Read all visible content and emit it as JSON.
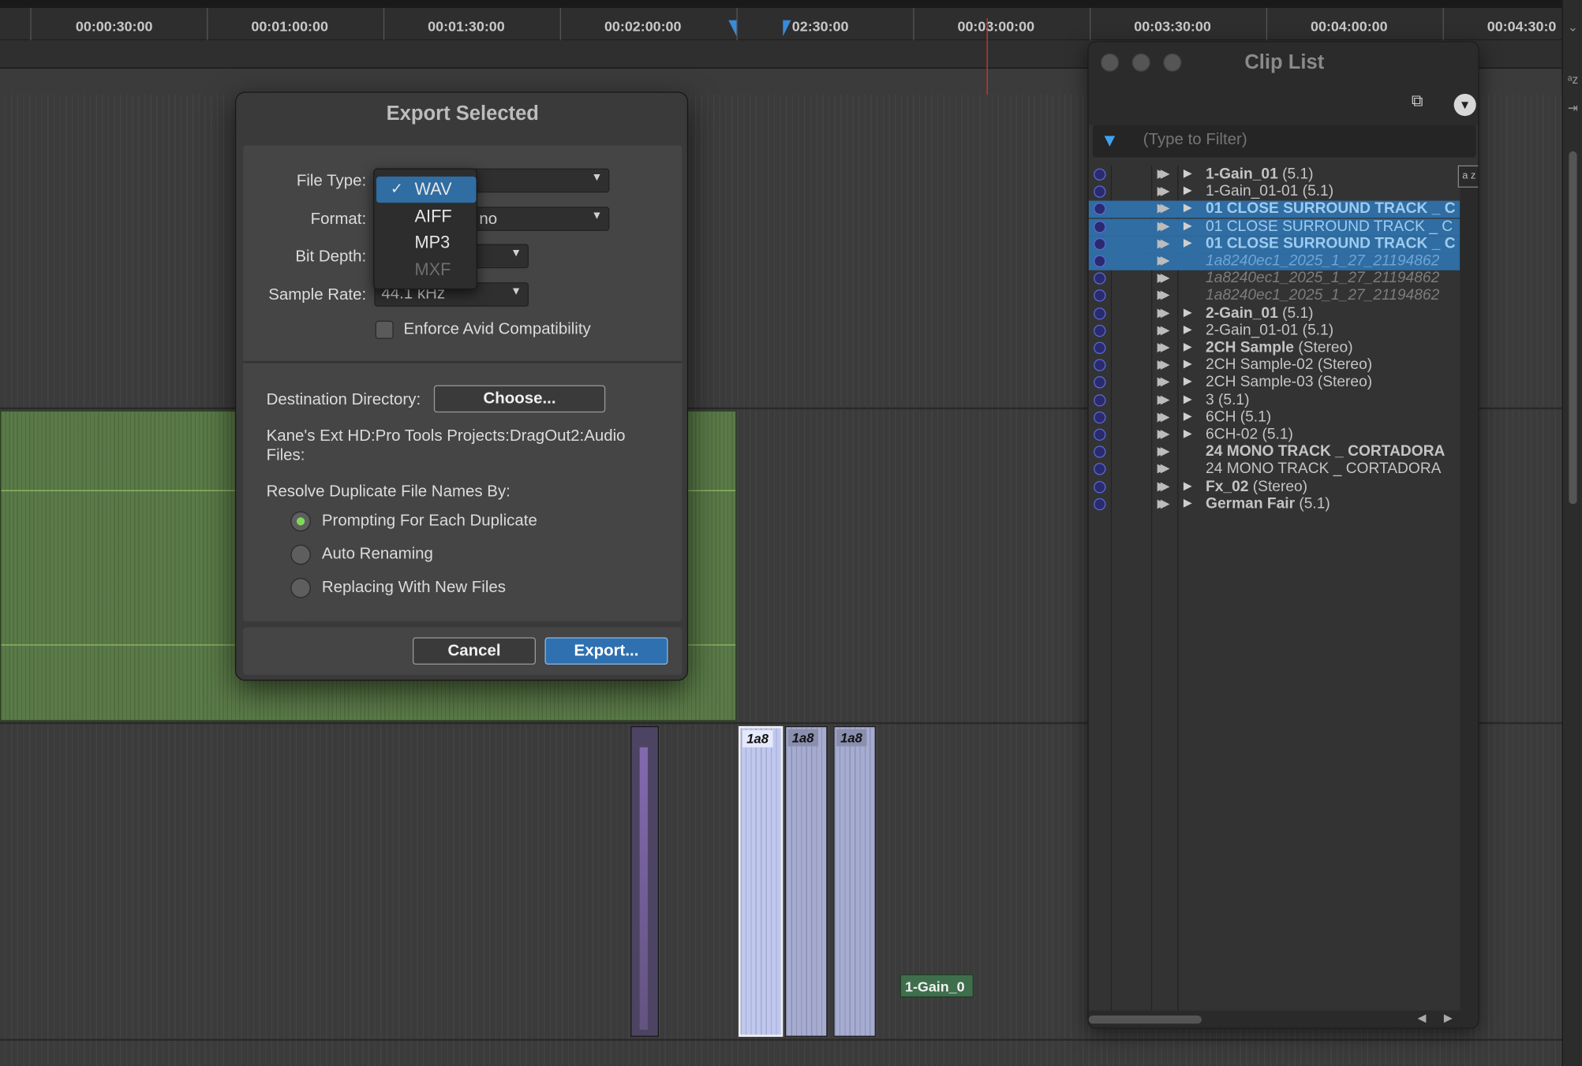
{
  "timeline": {
    "ruler_labels": [
      "00:00:30:00",
      "00:01:00:00",
      "00:01:30:00",
      "00:02:00:00",
      "02:30:00",
      "00:03:00:00",
      "00:03:30:00",
      "00:04:00:00",
      "00:04:30:0"
    ],
    "clips": {
      "region_name_1": "1a8",
      "region_name_2": "1a8",
      "region_name_3": "1a8",
      "bottom_clip_name": "1-Gain_0"
    }
  },
  "export_dialog": {
    "title": "Export Selected",
    "file_type_label": "File Type:",
    "format_label": "Format:",
    "format_value": "no",
    "bit_depth_label": "Bit Depth:",
    "sample_rate_label": "Sample Rate:",
    "sample_rate_value": "44.1 kHz",
    "enforce_label": "Enforce Avid Compatibility",
    "enforce_checked": false,
    "destination_label": "Destination Directory:",
    "choose_label": "Choose...",
    "destination_path": "Kane's Ext HD:Pro Tools Projects:DragOut2:Audio Files:",
    "resolve_label": "Resolve Duplicate File Names By:",
    "resolve_options": [
      {
        "label": "Prompting For Each Duplicate",
        "selected": true
      },
      {
        "label": "Auto Renaming",
        "selected": false
      },
      {
        "label": "Replacing With New Files",
        "selected": false
      }
    ],
    "cancel_label": "Cancel",
    "export_label": "Export...",
    "file_type_menu": {
      "items": [
        {
          "label": "WAV",
          "checked": true,
          "enabled": true
        },
        {
          "label": "AIFF",
          "checked": false,
          "enabled": true
        },
        {
          "label": "MP3",
          "checked": false,
          "enabled": true
        },
        {
          "label": "MXF",
          "checked": false,
          "enabled": false
        }
      ],
      "check_glyph": "✓"
    }
  },
  "clip_list": {
    "title": "Clip List",
    "filter_placeholder": "(Type to Filter)",
    "sort_button": "a z",
    "rows": [
      {
        "name": "1-Gain_01",
        "suffix": " (5.1)",
        "bold": true,
        "italic": false,
        "selected": false,
        "expandable": true
      },
      {
        "name": "1-Gain_01-01",
        "suffix": " (5.1)",
        "bold": false,
        "italic": false,
        "selected": false,
        "expandable": true
      },
      {
        "name": "01 CLOSE SURROUND TRACK _ C",
        "suffix": "",
        "bold": true,
        "italic": false,
        "selected": true,
        "expandable": true
      },
      {
        "name": "01 CLOSE SURROUND TRACK _ C",
        "suffix": "",
        "bold": false,
        "italic": false,
        "selected": true,
        "expandable": true
      },
      {
        "name": "01 CLOSE SURROUND TRACK _ C",
        "suffix": "",
        "bold": true,
        "italic": false,
        "selected": true,
        "expandable": true
      },
      {
        "name": "1a8240ec1_2025_1_27_21194862",
        "suffix": "",
        "bold": false,
        "italic": true,
        "selected": true,
        "expandable": false
      },
      {
        "name": "1a8240ec1_2025_1_27_21194862",
        "suffix": "",
        "bold": false,
        "italic": true,
        "selected": false,
        "expandable": false
      },
      {
        "name": "1a8240ec1_2025_1_27_21194862",
        "suffix": "",
        "bold": false,
        "italic": true,
        "selected": false,
        "expandable": false
      },
      {
        "name": "2-Gain_01",
        "suffix": " (5.1)",
        "bold": true,
        "italic": false,
        "selected": false,
        "expandable": true
      },
      {
        "name": "2-Gain_01-01",
        "suffix": " (5.1)",
        "bold": false,
        "italic": false,
        "selected": false,
        "expandable": true
      },
      {
        "name": "2CH Sample",
        "suffix": " (Stereo)",
        "bold": true,
        "italic": false,
        "selected": false,
        "expandable": true
      },
      {
        "name": "2CH Sample-02",
        "suffix": " (Stereo)",
        "bold": false,
        "italic": false,
        "selected": false,
        "expandable": true
      },
      {
        "name": "2CH Sample-03",
        "suffix": " (Stereo)",
        "bold": false,
        "italic": false,
        "selected": false,
        "expandable": true
      },
      {
        "name": "3",
        "suffix": " (5.1)",
        "bold": false,
        "italic": false,
        "selected": false,
        "expandable": true
      },
      {
        "name": "6CH",
        "suffix": " (5.1)",
        "bold": false,
        "italic": false,
        "selected": false,
        "expandable": true
      },
      {
        "name": "6CH-02",
        "suffix": " (5.1)",
        "bold": false,
        "italic": false,
        "selected": false,
        "expandable": true
      },
      {
        "name": "24 MONO TRACK _ CORTADORA",
        "suffix": "",
        "bold": true,
        "italic": false,
        "selected": false,
        "expandable": false
      },
      {
        "name": "24 MONO TRACK _ CORTADORA",
        "suffix": "",
        "bold": false,
        "italic": false,
        "selected": false,
        "expandable": false
      },
      {
        "name": "Fx_02",
        "suffix": " (Stereo)",
        "bold": true,
        "italic": false,
        "selected": false,
        "expandable": true
      },
      {
        "name": "German Fair",
        "suffix": " (5.1)",
        "bold": true,
        "italic": false,
        "selected": false,
        "expandable": true
      }
    ]
  },
  "colors": {
    "accent_blue": "#2f6da3",
    "export_button": "#2f70b0",
    "playhead": "#e03030",
    "green_clip": "#5a7a48",
    "radio_on": "#7ed957"
  }
}
